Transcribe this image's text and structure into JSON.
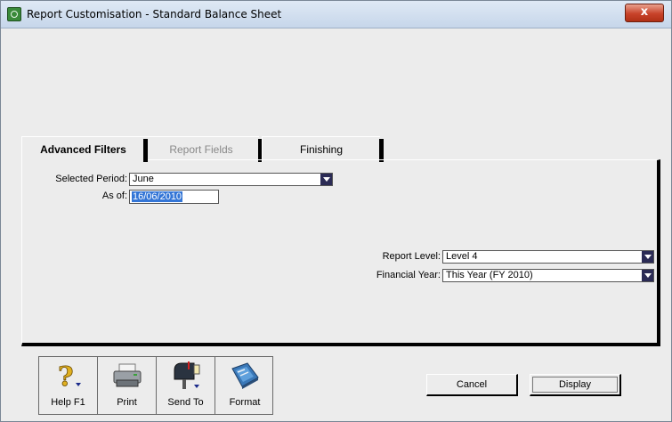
{
  "window": {
    "title": "Report Customisation - Standard Balance Sheet",
    "close_glyph": "x"
  },
  "tabs": [
    {
      "label": "Advanced Filters",
      "state": "active"
    },
    {
      "label": "Report Fields",
      "state": "disabled"
    },
    {
      "label": "Finishing",
      "state": "normal"
    }
  ],
  "filters": {
    "selected_period": {
      "label": "Selected Period:",
      "value": "June"
    },
    "as_of": {
      "label": "As of:",
      "value": "16/06/2010"
    },
    "report_level": {
      "label": "Report Level:",
      "value": "Level 4"
    },
    "financial_year": {
      "label": "Financial Year:",
      "value": "This Year (FY 2010)"
    }
  },
  "toolbar": [
    {
      "label": "Help F1",
      "icon": "help-icon"
    },
    {
      "label": "Print",
      "icon": "printer-icon"
    },
    {
      "label": "Send To",
      "icon": "mailbox-icon"
    },
    {
      "label": "Format",
      "icon": "format-icon"
    }
  ],
  "actions": {
    "cancel": "Cancel",
    "display": "Display"
  },
  "colors": {
    "selection": "#3375d6",
    "close_button": "#c8432a"
  }
}
